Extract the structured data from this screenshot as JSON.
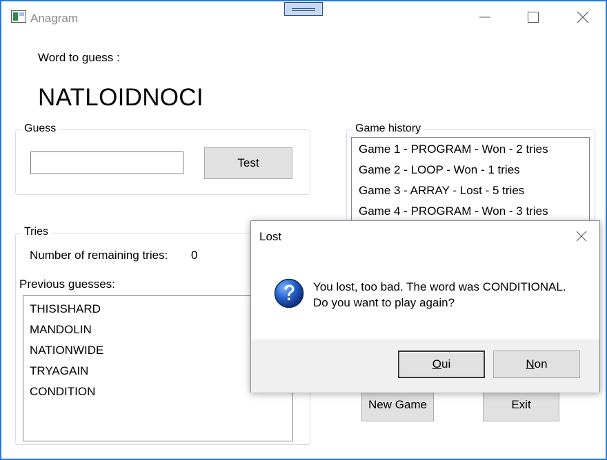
{
  "window": {
    "title": "Anagram"
  },
  "word": {
    "label": "Word to guess :",
    "scrambled": "NATLOIDNOCI"
  },
  "guess": {
    "group_label": "Guess",
    "input_value": "",
    "test_label": "Test"
  },
  "tries": {
    "group_label": "Tries",
    "remaining_label": "Number of remaining tries:",
    "remaining_value": "0",
    "previous_label": "Previous guesses:",
    "previous": [
      "THISISHARD",
      "MANDOLIN",
      "NATIONWIDE",
      "TRYAGAIN",
      "CONDITION"
    ]
  },
  "history": {
    "group_label": "Game history",
    "items": [
      "Game 1 - PROGRAM - Won - 2 tries",
      "Game 2 - LOOP - Won - 1 tries",
      "Game 3 - ARRAY - Lost - 5 tries",
      "Game 4 - PROGRAM - Won - 3 tries"
    ]
  },
  "actions": {
    "new_game": "New Game",
    "exit": "Exit"
  },
  "dialog": {
    "title": "Lost",
    "message_line1": "You lost, too bad. The word was CONDITIONAL.",
    "message_line2": "Do you want to play again?",
    "yes_label": "Oui",
    "no_label": "Non"
  },
  "icons": {
    "app": "app-window-icon",
    "minimize": "minimize-icon",
    "maximize": "maximize-icon",
    "close": "close-icon",
    "question": "question-icon"
  },
  "colors": {
    "window_border": "#1f7ad9",
    "question_blue": "#1a4fb0"
  }
}
